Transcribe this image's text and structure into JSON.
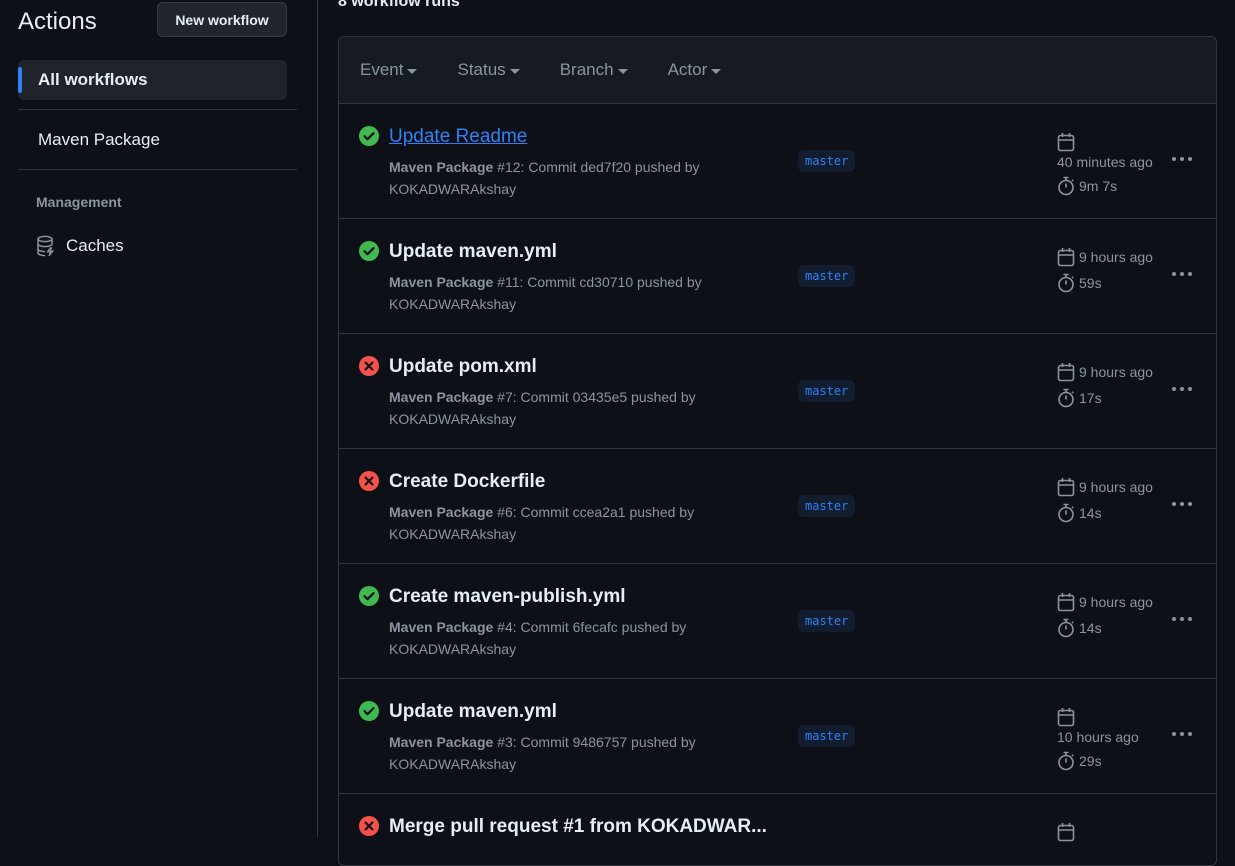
{
  "sidebar": {
    "title": "Actions",
    "new_workflow_label": "New workflow",
    "items": [
      {
        "label": "All workflows",
        "active": true
      },
      {
        "label": "Maven Package",
        "active": false
      }
    ],
    "section_label": "Management",
    "caches_label": "Caches"
  },
  "main": {
    "run_count": "8 workflow runs",
    "filters": [
      {
        "label": "Event"
      },
      {
        "label": "Status"
      },
      {
        "label": "Branch"
      },
      {
        "label": "Actor"
      }
    ],
    "runs": [
      {
        "status": "success",
        "title": "Update Readme",
        "workflow": "Maven Package",
        "detail": " #12: Commit ded7f20 pushed by",
        "actor": "KOKADWARAkshay",
        "branch": "master",
        "when": "40 minutes ago",
        "duration": "9m 7s",
        "hovered": true
      },
      {
        "status": "success",
        "title": "Update maven.yml",
        "workflow": "Maven Package",
        "detail": " #11: Commit cd30710 pushed by",
        "actor": "KOKADWARAkshay",
        "branch": "master",
        "when": "9 hours ago",
        "duration": "59s"
      },
      {
        "status": "failure",
        "title": "Update pom.xml",
        "workflow": "Maven Package",
        "detail": " #7: Commit 03435e5 pushed by",
        "actor": "KOKADWARAkshay",
        "branch": "master",
        "when": "9 hours ago",
        "duration": "17s"
      },
      {
        "status": "failure",
        "title": "Create Dockerfile",
        "workflow": "Maven Package",
        "detail": " #6: Commit ccea2a1 pushed by",
        "actor": "KOKADWARAkshay",
        "branch": "master",
        "when": "9 hours ago",
        "duration": "14s"
      },
      {
        "status": "success",
        "title": "Create maven-publish.yml",
        "workflow": "Maven Package",
        "detail": " #4: Commit 6fecafc pushed by",
        "actor": "KOKADWARAkshay",
        "branch": "master",
        "when": "9 hours ago",
        "duration": "14s"
      },
      {
        "status": "success",
        "title": "Update maven.yml",
        "workflow": "Maven Package",
        "detail": " #3: Commit 9486757 pushed by",
        "actor": "KOKADWARAkshay",
        "branch": "master",
        "when": "10 hours ago",
        "duration": "29s"
      },
      {
        "status": "failure",
        "title": "Merge pull request #1 from KOKADWAR...",
        "workflow": "",
        "detail": "",
        "actor": "",
        "branch": "",
        "when": "",
        "duration": ""
      }
    ]
  },
  "colors": {
    "success": "#3fb950",
    "failure": "#f85149",
    "accent": "#2f81f7",
    "muted": "#8b949e"
  },
  "icons": {
    "success": "check-circle-icon",
    "failure": "x-circle-icon",
    "calendar": "calendar-icon",
    "stopwatch": "stopwatch-icon",
    "kebab": "kebab-horizontal-icon",
    "caches": "database-icon"
  }
}
